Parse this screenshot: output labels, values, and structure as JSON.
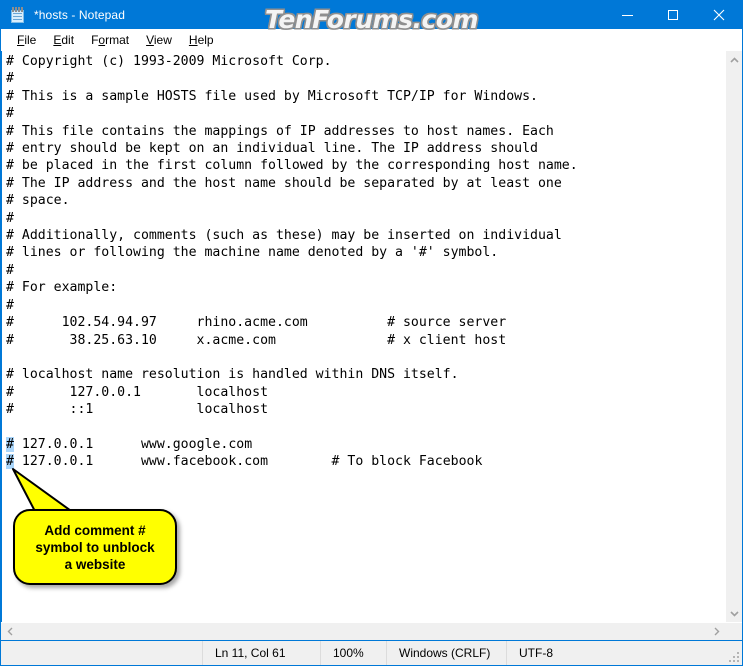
{
  "window": {
    "title": "*hosts - Notepad",
    "icon": "notepad-icon",
    "watermark": "TenForums.com",
    "accent_color": "#0078d7",
    "controls": {
      "minimize": "Minimize",
      "maximize": "Maximize",
      "close": "Close"
    }
  },
  "menubar": {
    "items": [
      {
        "label": "File",
        "access_key": "F"
      },
      {
        "label": "Edit",
        "access_key": "E"
      },
      {
        "label": "Format",
        "access_key": "o"
      },
      {
        "label": "View",
        "access_key": "V"
      },
      {
        "label": "Help",
        "access_key": "H"
      }
    ]
  },
  "editor": {
    "selection_color": "#aad6fb",
    "lines": [
      {
        "text": "# Copyright (c) 1993-2009 Microsoft Corp."
      },
      {
        "text": "#"
      },
      {
        "text": "# This is a sample HOSTS file used by Microsoft TCP/IP for Windows."
      },
      {
        "text": "#"
      },
      {
        "text": "# This file contains the mappings of IP addresses to host names. Each"
      },
      {
        "text": "# entry should be kept on an individual line. The IP address should"
      },
      {
        "text": "# be placed in the first column followed by the corresponding host name."
      },
      {
        "text": "# The IP address and the host name should be separated by at least one"
      },
      {
        "text": "# space."
      },
      {
        "text": "#"
      },
      {
        "text": "# Additionally, comments (such as these) may be inserted on individual"
      },
      {
        "text": "# lines or following the machine name denoted by a '#' symbol."
      },
      {
        "text": "#"
      },
      {
        "text": "# For example:"
      },
      {
        "text": "#"
      },
      {
        "text": "#      102.54.94.97     rhino.acme.com          # source server"
      },
      {
        "text": "#       38.25.63.10     x.acme.com              # x client host"
      },
      {
        "text": ""
      },
      {
        "text": "# localhost name resolution is handled within DNS itself."
      },
      {
        "text": "#       127.0.0.1       localhost"
      },
      {
        "text": "#       ::1             localhost"
      },
      {
        "text": ""
      },
      {
        "selected": "#",
        "text": " 127.0.0.1      www.google.com"
      },
      {
        "selected": "#",
        "text": " 127.0.0.1      www.facebook.com        # To block Facebook"
      }
    ]
  },
  "callout": {
    "text": "Add comment #\nsymbol to unblock\na website",
    "fill_color": "#ffff00",
    "border_color": "#000000"
  },
  "scrollbars": {
    "vertical": {
      "up": "scroll-up",
      "down": "scroll-down"
    },
    "horizontal": {
      "left": "scroll-left",
      "right": "scroll-right"
    }
  },
  "statusbar": {
    "cursor_position": "Ln 11, Col 61",
    "zoom": "100%",
    "line_ending": "Windows (CRLF)",
    "encoding": "UTF-8"
  }
}
